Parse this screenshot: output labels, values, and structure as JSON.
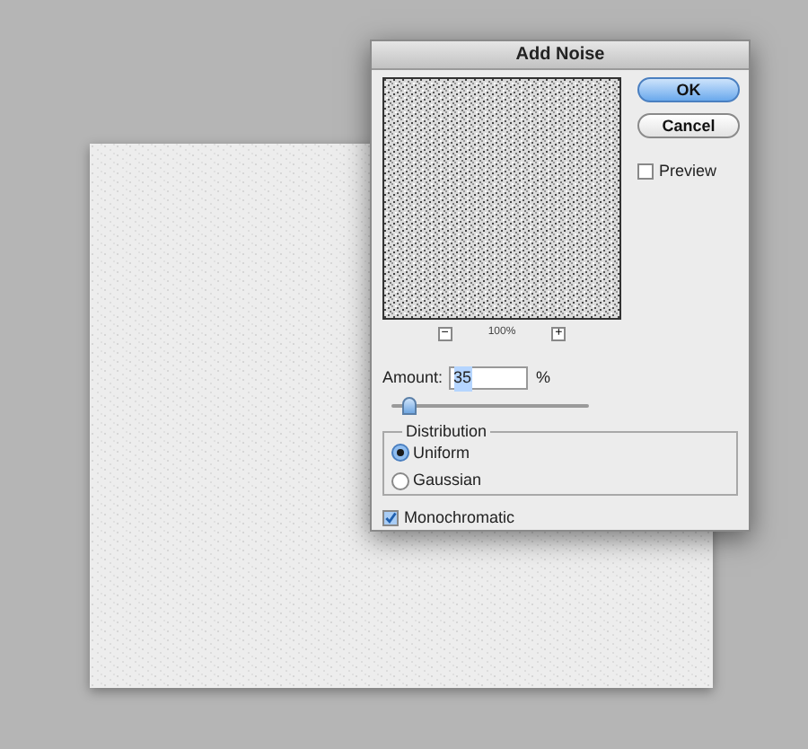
{
  "window": {
    "title": "Add Noise"
  },
  "buttons": [
    {
      "label": "OK",
      "default": true
    },
    {
      "label": "Cancel",
      "default": false
    }
  ],
  "preview": {
    "label": "Preview",
    "checked": false
  },
  "zoom": {
    "minus": "−",
    "level": "100%",
    "plus": "+"
  },
  "amount": {
    "label": "Amount:",
    "value": "35",
    "unit": "%",
    "level": 0.09
  },
  "distribution": {
    "title": "Distribution",
    "options": [
      {
        "label": "Uniform",
        "selected": true
      },
      {
        "label": "Gaussian",
        "selected": false
      }
    ]
  },
  "monochromatic": {
    "label": "Monochromatic",
    "checked": true
  }
}
